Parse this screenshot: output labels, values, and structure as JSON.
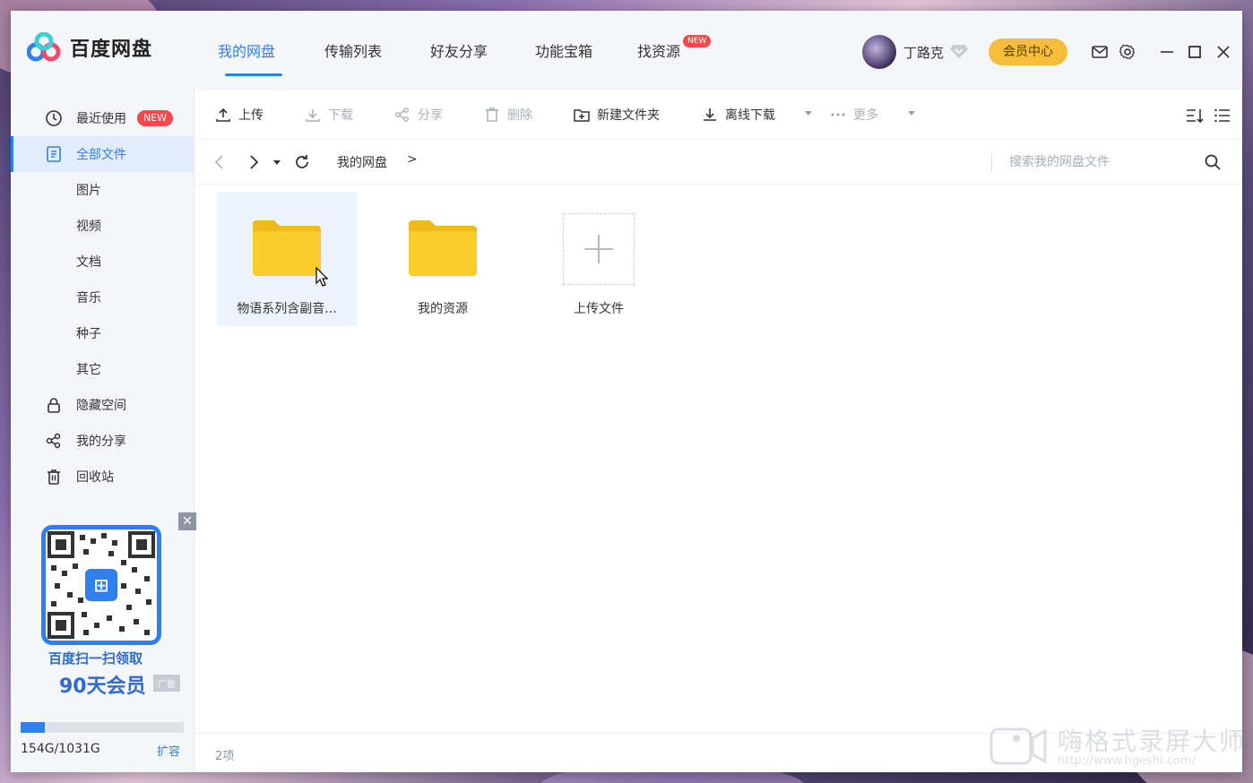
{
  "app": {
    "name": "百度网盘",
    "colors": {
      "accent": "#2f80ed",
      "folder": "#f5c623",
      "new_badge": "#f24a4a",
      "member": "#f5bd3a"
    }
  },
  "nav": {
    "tabs": [
      {
        "label": "我的网盘",
        "active": true
      },
      {
        "label": "传输列表"
      },
      {
        "label": "好友分享"
      },
      {
        "label": "功能宝箱"
      },
      {
        "label": "找资源"
      }
    ],
    "new_badge": "NEW"
  },
  "user": {
    "name": "丁路克",
    "member_button": "会员中心"
  },
  "window_icons": [
    "mail-icon",
    "gear-icon",
    "minimize-icon",
    "maximize-icon",
    "close-icon"
  ],
  "sidebar": {
    "items": [
      {
        "label": "最近使用",
        "icon": "clock-icon",
        "badge": "NEW"
      },
      {
        "label": "全部文件",
        "icon": "document-icon",
        "active": true
      },
      {
        "label": "图片"
      },
      {
        "label": "视频"
      },
      {
        "label": "文档"
      },
      {
        "label": "音乐"
      },
      {
        "label": "种子"
      },
      {
        "label": "其它"
      },
      {
        "label": "隐藏空间",
        "icon": "lock-icon"
      },
      {
        "label": "我的分享",
        "icon": "share-icon"
      },
      {
        "label": "回收站",
        "icon": "trash-icon"
      }
    ],
    "ad": {
      "line1": "百度扫一扫领取",
      "line2": "90天会员",
      "tag": "广告",
      "close": "✕"
    },
    "storage": {
      "used_total": "154G/1031G",
      "used_fraction": 0.15,
      "expand": "扩容"
    }
  },
  "toolbar": {
    "upload": "上传",
    "download": "下载",
    "share": "分享",
    "delete": "删除",
    "new_folder": "新建文件夹",
    "offline_download": "离线下载",
    "more": "更多"
  },
  "address": {
    "breadcrumb": "我的网盘",
    "separator": ">",
    "search_placeholder": "搜索我的网盘文件"
  },
  "files": [
    {
      "name": "物语系列含副音...",
      "type": "folder"
    },
    {
      "name": "我的资源",
      "type": "folder"
    },
    {
      "name": "上传文件",
      "type": "upload"
    }
  ],
  "status": {
    "count": "2项"
  },
  "watermark": {
    "text": "嗨格式录屏大师",
    "url": "http://www.hgeshi.com/"
  }
}
